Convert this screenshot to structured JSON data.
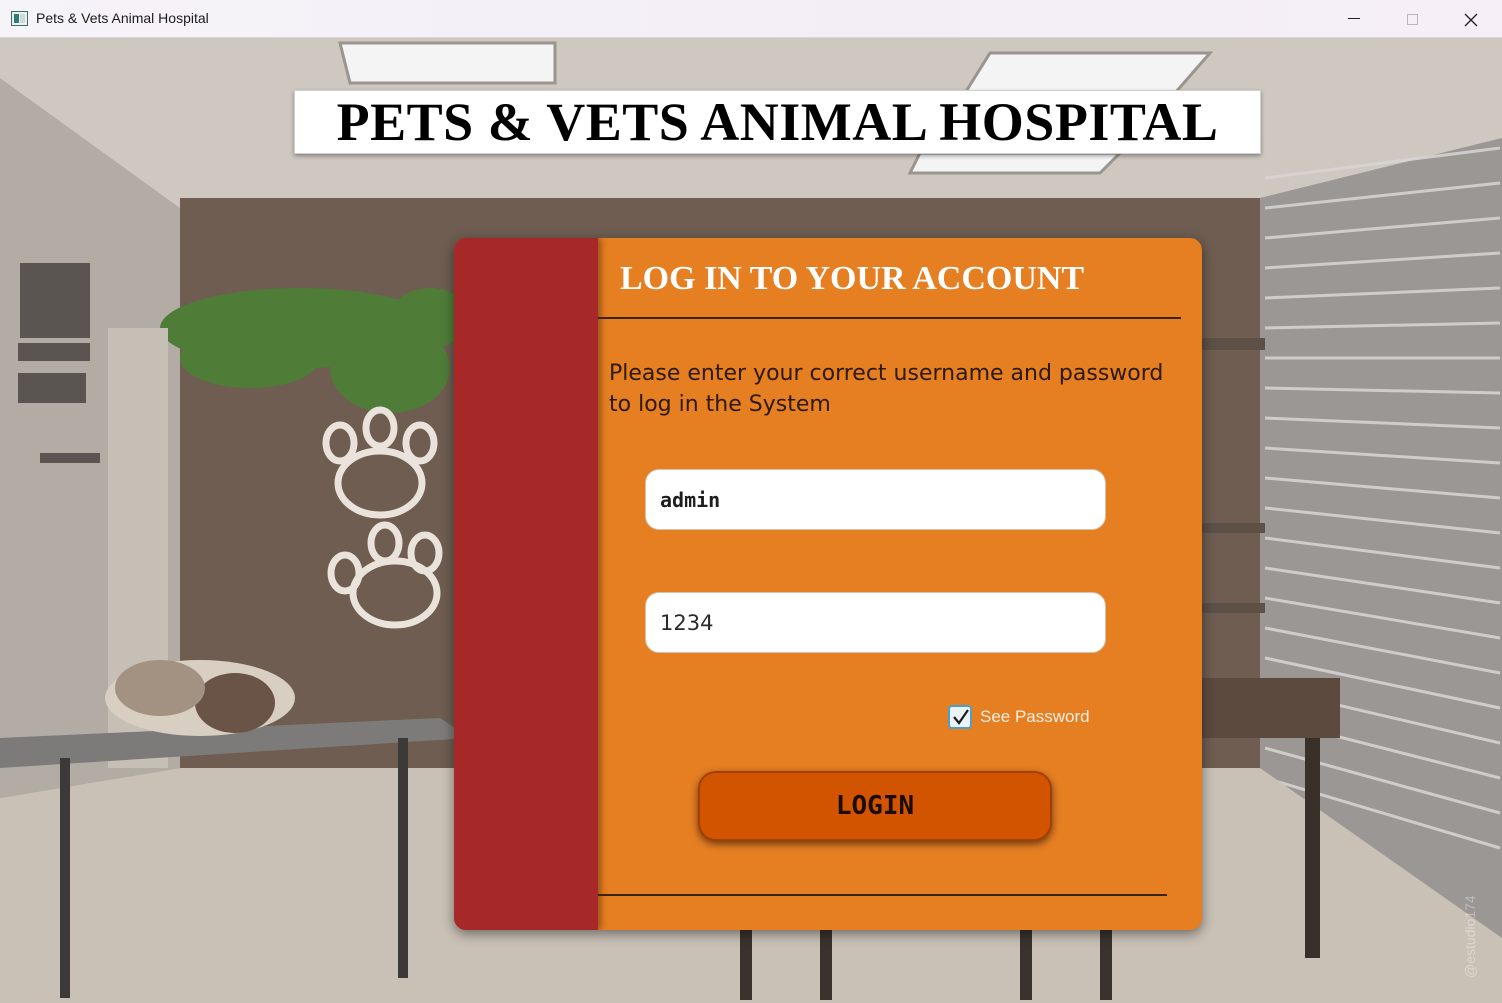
{
  "window": {
    "title": "Pets & Vets Animal Hospital",
    "controls": [
      "minimize-icon",
      "maximize-icon",
      "close-icon"
    ]
  },
  "banner": {
    "title": "PETS & VETS ANIMAL HOSPITAL"
  },
  "login_card": {
    "heading": "LOG IN TO YOUR ACCOUNT",
    "instructions": "Please enter your correct username and password to log in the System",
    "username_value": "admin",
    "password_value": "1234",
    "see_password_label": "See Password",
    "see_password_checked": true,
    "login_button_label": "LOGIN"
  },
  "background": {
    "watermark": "@estudio174"
  },
  "colors": {
    "card": "#e67e22",
    "stripe": "#a62828",
    "login_button": "#d35400"
  }
}
